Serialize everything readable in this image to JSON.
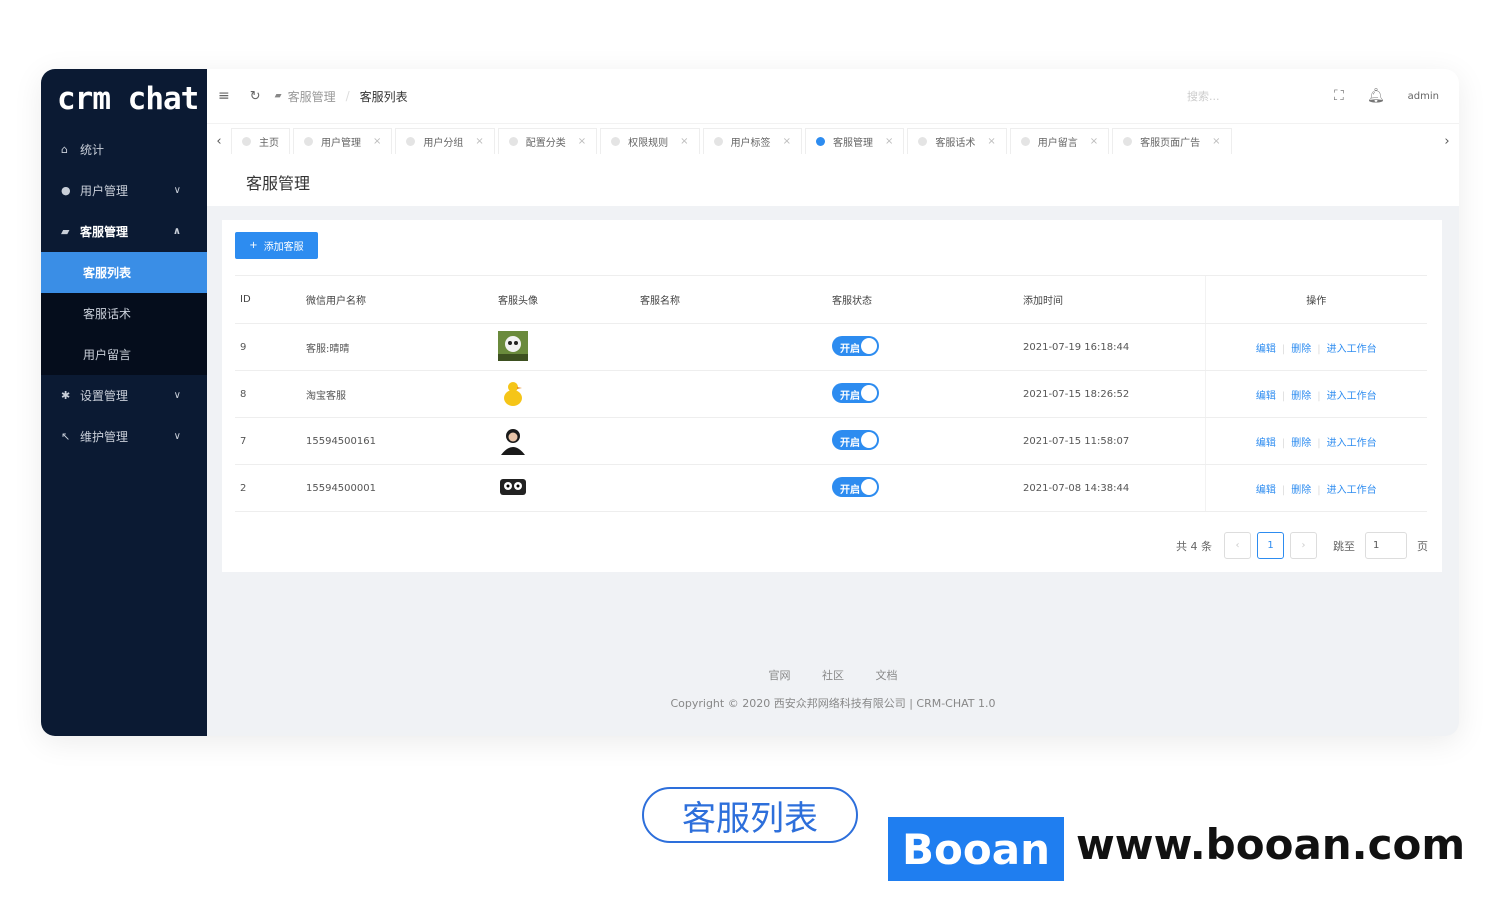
{
  "app": {
    "logo_text": "crm chat"
  },
  "sidebar": {
    "items": [
      {
        "label": "统计",
        "icon": "home-icon"
      },
      {
        "label": "用户管理",
        "icon": "user-icon"
      },
      {
        "label": "客服管理",
        "icon": "chat-icon"
      },
      {
        "label": "设置管理",
        "icon": "gear-icon"
      },
      {
        "label": "维护管理",
        "icon": "wrench-icon"
      }
    ],
    "sub_items": [
      "客服列表",
      "客服话术",
      "用户留言"
    ]
  },
  "topbar": {
    "breadcrumb": [
      "客服管理",
      "客服列表"
    ],
    "search_placeholder": "搜索...",
    "user": "admin"
  },
  "tabs": [
    "主页",
    "用户管理",
    "用户分组",
    "配置分类",
    "权限规则",
    "用户标签",
    "客服管理",
    "客服话术",
    "用户留言",
    "客服页面广告"
  ],
  "page_title": "客服管理",
  "add_button": "添加客服",
  "table": {
    "headers": [
      "ID",
      "微信用户名称",
      "客服头像",
      "客服名称",
      "客服状态",
      "添加时间",
      "操作"
    ],
    "rows": [
      {
        "id": "9",
        "wx_name": "客服:晴晴",
        "kf_name": "",
        "status": "开启",
        "time": "2021-07-19 16:18:44"
      },
      {
        "id": "8",
        "wx_name": "淘宝客服",
        "kf_name": "",
        "status": "开启",
        "time": "2021-07-15 18:26:52"
      },
      {
        "id": "7",
        "wx_name": "15594500161",
        "kf_name": "",
        "status": "开启",
        "time": "2021-07-15 11:58:07"
      },
      {
        "id": "2",
        "wx_name": "15594500001",
        "kf_name": "",
        "status": "开启",
        "time": "2021-07-08 14:38:44"
      }
    ],
    "actions": {
      "edit": "编辑",
      "delete": "删除",
      "enter": "进入工作台"
    }
  },
  "pagination": {
    "total_text": "共 4 条",
    "current": "1",
    "jump_label": "跳至",
    "jump_value": "1",
    "page_suffix": "页"
  },
  "footer": {
    "links": [
      "官网",
      "社区",
      "文档"
    ],
    "copyright": "Copyright © 2020 西安众邦网络科技有限公司 | CRM-CHAT 1.0"
  },
  "caption": "客服列表",
  "watermark": {
    "brand": "Booan",
    "url": "www.booan.com"
  },
  "colors": {
    "sidebar_bg": "#0b1a33",
    "accent": "#2d8cf0"
  }
}
